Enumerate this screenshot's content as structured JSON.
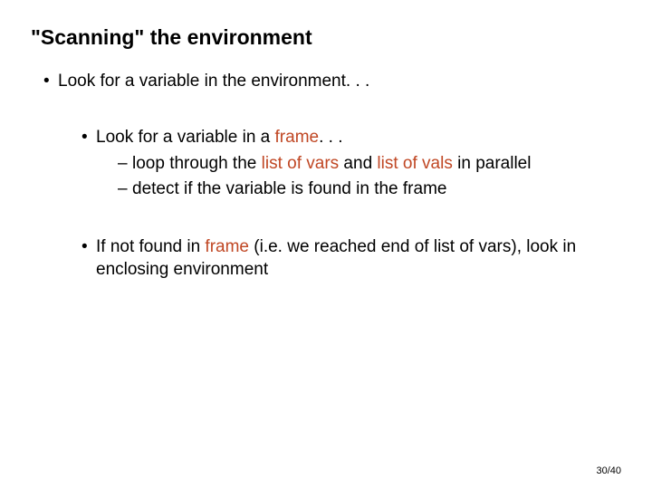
{
  "title": "\"Scanning\" the environment",
  "b1": "Look for a variable in the environment. . .",
  "b2_pre": "Look for a variable in a ",
  "b2_kw": "frame",
  "b2_post": ". . .",
  "b3a_pre": "loop through the ",
  "b3a_kw1": "list of vars",
  "b3a_mid": " and ",
  "b3a_kw2": "list of vals",
  "b3a_post": " in parallel",
  "b3b": "detect if the variable is found in the frame",
  "b4_pre": "If not found in ",
  "b4_kw": "frame",
  "b4_post": " (i.e. we reached end of list of vars), look in enclosing environment",
  "page": "30/40"
}
